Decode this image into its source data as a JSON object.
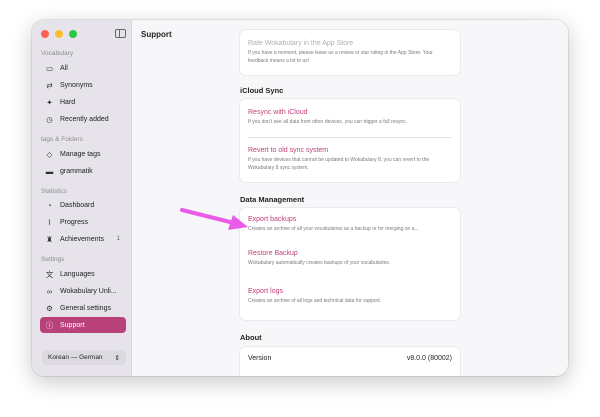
{
  "sidebar": {
    "sections": {
      "vocabulary": "Vocabulary",
      "tags": "tags & Folders",
      "statistics": "Statistics",
      "settings": "Settings"
    },
    "items": {
      "all": "All",
      "synonyms": "Synonyms",
      "hard": "Hard",
      "recently_added": "Recently added",
      "manage_tags": "Manage tags",
      "grammatik": "grammatik",
      "dashboard": "Dashboard",
      "progress": "Progress",
      "achievements": "Achievements",
      "achievements_badge": "1",
      "languages": "Languages",
      "wokabulary_unli": "Wokabulary Unli...",
      "general_settings": "General settings",
      "support": "Support"
    },
    "language_pair": "Korean — German"
  },
  "main": {
    "title": "Support",
    "rate": {
      "title": "Rate Wokabulary in the App Store",
      "desc": "If you have a moment, please leave us a review or star rating in the App Store. Your feedback means a lot to us!"
    },
    "icloud": {
      "heading": "iCloud Sync",
      "resync_title": "Resync with iCloud",
      "resync_desc": "If you don't see all data from other devices, you can trigger a full resync.",
      "revert_title": "Revert to old sync system",
      "revert_desc": "If you have devices that cannot be updated to Wokabulary 8, you can revert to the Wokabulary 8 sync system."
    },
    "data_management": {
      "heading": "Data Management",
      "export_title": "Export backups",
      "export_desc": "Creates an archive of all your vocabularies as a backup or for merging on a...",
      "restore_title": "Restore Backup",
      "restore_desc": "Wokabulary automatically creates backups of your vocabularies.",
      "logs_title": "Export logs",
      "logs_desc": "Creates an archive of all logs and technical data for support."
    },
    "about": {
      "heading": "About",
      "version_label": "Version",
      "version_value": "v8.0.0 (80002)"
    }
  },
  "colors": {
    "accent": "#c0417b",
    "sidebar_active": "#b8417a",
    "annotation_arrow": "#e85ce8"
  },
  "icons": {
    "all": "tray-icon",
    "synonyms": "synonyms-icon",
    "hard": "sparkle-icon",
    "recently_added": "clock-icon",
    "manage_tags": "tag-icon",
    "grammatik": "folder-icon",
    "dashboard": "dashboard-icon",
    "progress": "chart-icon",
    "achievements": "trophy-icon",
    "languages": "languages-icon",
    "unlimited": "infinity-icon",
    "general_settings": "gear-icon",
    "support": "help-icon"
  }
}
